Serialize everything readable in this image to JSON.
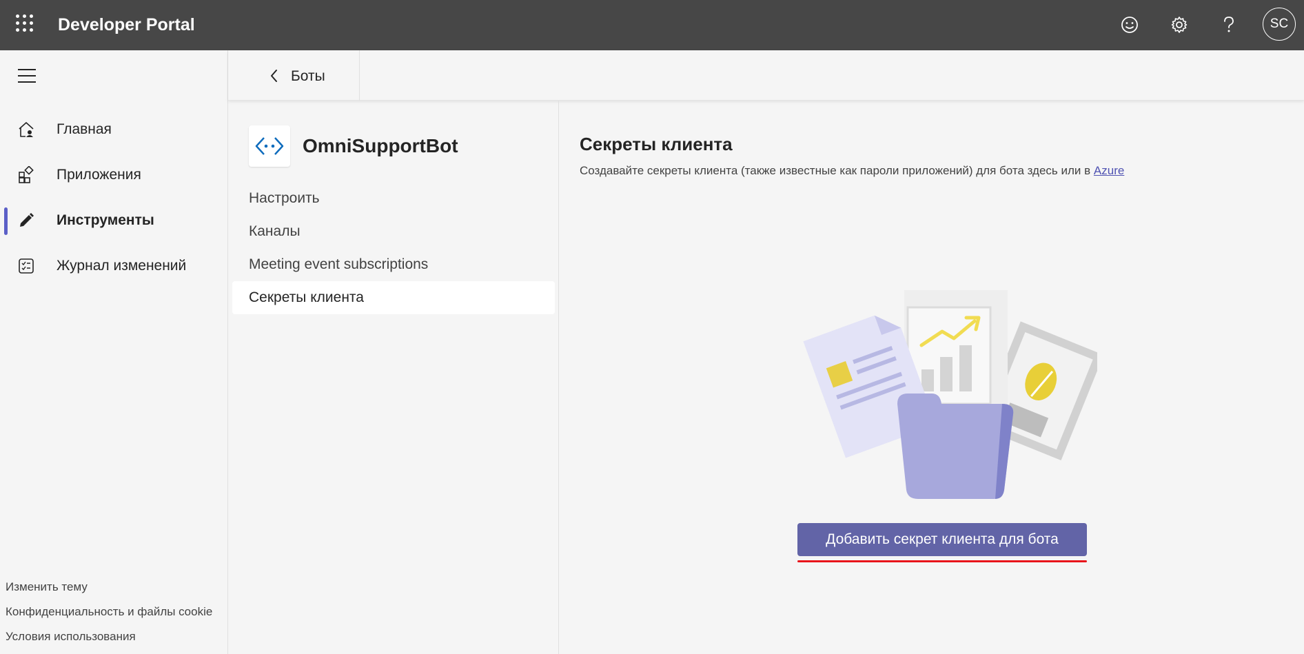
{
  "app": {
    "title": "Developer Portal",
    "avatar_initials": "SC"
  },
  "leftnav": {
    "items": [
      {
        "label": "Главная",
        "icon": "home-icon"
      },
      {
        "label": "Приложения",
        "icon": "apps-icon"
      },
      {
        "label": "Инструменты",
        "icon": "pencil-icon",
        "active": true
      },
      {
        "label": "Журнал изменений",
        "icon": "changelog-icon"
      }
    ],
    "footer": {
      "theme": "Изменить тему",
      "privacy": "Конфиденциальность и файлы cookie",
      "terms": "Условия использования"
    }
  },
  "breadcrumb": {
    "back_label": "Боты"
  },
  "bot": {
    "name": "OmniSupportBot",
    "menu": [
      {
        "label": "Настроить"
      },
      {
        "label": "Каналы"
      },
      {
        "label": "Meeting event subscriptions"
      },
      {
        "label": "Секреты клиента",
        "active": true
      }
    ]
  },
  "main": {
    "title": "Секреты клиента",
    "description": "Создавайте секреты клиента (также известные как пароли приложений) для бота здесь или в",
    "link_label": "Azure",
    "button_label": "Добавить секрет клиента для бота"
  },
  "colors": {
    "topbar": "#474747",
    "accent": "#5b5fc7",
    "button": "#6264a7",
    "underline": "#e8151b"
  }
}
